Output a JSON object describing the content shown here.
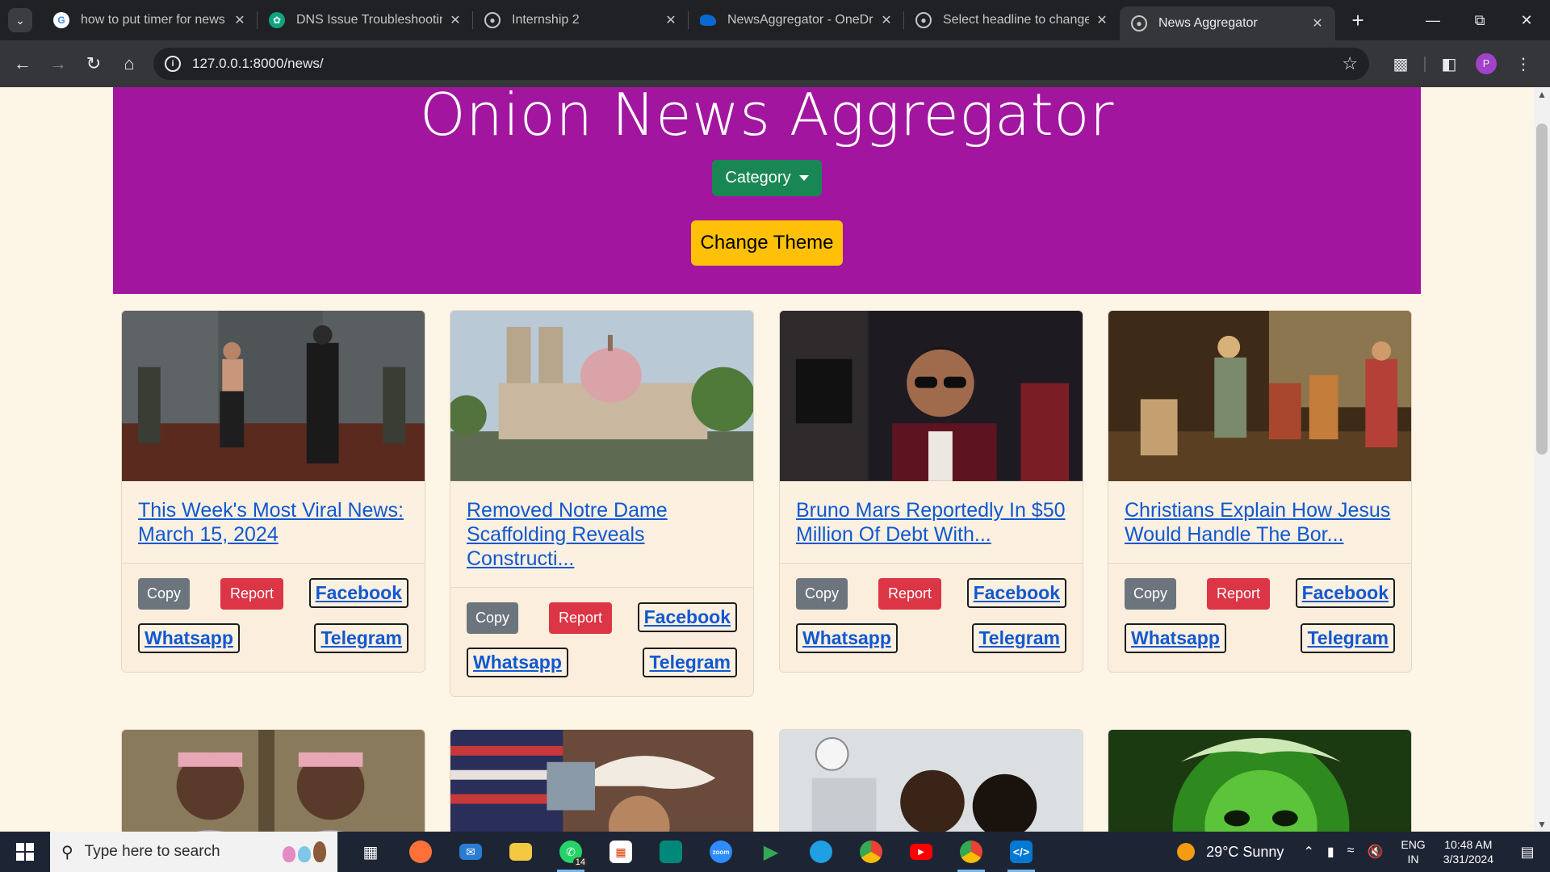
{
  "browser": {
    "tabs": [
      {
        "title": "how to put timer for news",
        "favicon": "google-icon",
        "active": false
      },
      {
        "title": "DNS Issue Troubleshooting",
        "favicon": "chatgpt-icon",
        "active": false
      },
      {
        "title": "Internship 2",
        "favicon": "globe-icon",
        "active": false
      },
      {
        "title": "NewsAggregator - OneDrive",
        "favicon": "onedrive-icon",
        "active": false
      },
      {
        "title": "Select headline to change | Django",
        "favicon": "globe-icon",
        "active": false
      },
      {
        "title": "News Aggregator",
        "favicon": "globe-icon",
        "active": true
      }
    ],
    "url": "127.0.0.1:8000/news/",
    "profile_initial": "P"
  },
  "page": {
    "site_title": "Onion News Aggregator",
    "category_label": "Category",
    "theme_label": "Change Theme",
    "colors": {
      "hero": "#a2169f",
      "category": "#198754",
      "theme": "#ffc107",
      "report": "#dc3545",
      "copy": "#6c757d",
      "link": "#1058d0"
    }
  },
  "cards": [
    {
      "headline": "This Week's Most Viral News: March 15, 2024",
      "image": "men-in-grey-room-photo",
      "copy": "Copy",
      "report": "Report",
      "facebook": "Facebook",
      "whatsapp": "Whatsapp",
      "telegram": "Telegram"
    },
    {
      "headline": "Removed Notre Dame Scaffolding Reveals Constructi...",
      "image": "cathedral-with-mosque-dome-photo",
      "copy": "Copy",
      "report": "Report",
      "facebook": "Facebook",
      "whatsapp": "Whatsapp",
      "telegram": "Telegram"
    },
    {
      "headline": "Bruno Mars Reportedly In $50 Million Of Debt With...",
      "image": "singer-with-sunglasses-photo",
      "copy": "Copy",
      "report": "Report",
      "facebook": "Facebook",
      "whatsapp": "Whatsapp",
      "telegram": "Telegram"
    },
    {
      "headline": "Christians Explain How Jesus Would Handle The Bor...",
      "image": "religious-painting-photo",
      "copy": "Copy",
      "report": "Report",
      "facebook": "Facebook",
      "whatsapp": "Whatsapp",
      "telegram": "Telegram"
    },
    {
      "image": "two-women-sitcom-photo"
    },
    {
      "image": "woman-cowboy-hat-flag-photo"
    },
    {
      "image": "doctor-and-patient-photo"
    },
    {
      "image": "green-ghoul-face-photo"
    }
  ],
  "taskbar": {
    "search_placeholder": "Type here to search",
    "whatsapp_badge": "14",
    "weather": "29°C  Sunny",
    "lang_top": "ENG",
    "lang_bottom": "IN",
    "time": "10:48 AM",
    "date": "3/31/2024"
  }
}
